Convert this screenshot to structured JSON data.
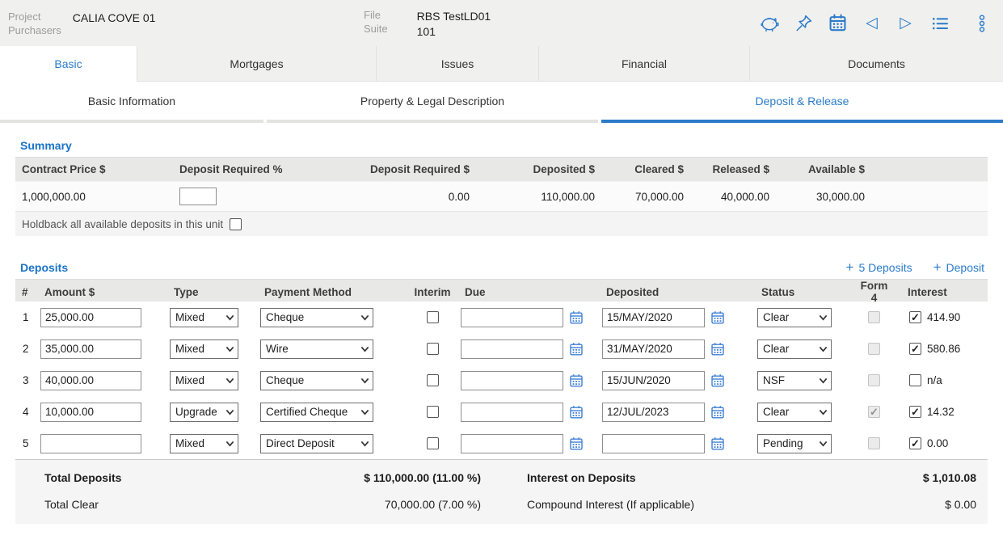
{
  "header": {
    "project_label": [
      "Project",
      "Purchasers"
    ],
    "project_value": "CALIA COVE 01",
    "file_label": [
      "File",
      "Suite"
    ],
    "file_value": [
      "RBS TestLD01",
      "101"
    ],
    "icons": [
      "piggy-bank",
      "pushpin",
      "calendar",
      "previous",
      "next",
      "list",
      "more-options"
    ]
  },
  "tabs": [
    {
      "label": "Basic",
      "active": true
    },
    {
      "label": "Mortgages",
      "active": false
    },
    {
      "label": "Issues",
      "active": false
    },
    {
      "label": "Financial",
      "active": false
    },
    {
      "label": "Documents",
      "active": false
    }
  ],
  "subtabs": [
    {
      "label": "Basic Information",
      "active": false
    },
    {
      "label": "Property & Legal Description",
      "active": false
    },
    {
      "label": "Deposit & Release",
      "active": true
    }
  ],
  "summary": {
    "title": "Summary",
    "columns": [
      "Contract Price $",
      "Deposit Required %",
      "Deposit Required $",
      "Deposited $",
      "Cleared $",
      "Released $",
      "Available $"
    ],
    "row": {
      "contract_price": "1,000,000.00",
      "deposit_required_pct": "",
      "deposit_required": "0.00",
      "deposited": "110,000.00",
      "cleared": "70,000.00",
      "released": "40,000.00",
      "available": "30,000.00"
    },
    "holdback_label": "Holdback all available deposits in this unit",
    "holdback_checked": false
  },
  "deposits": {
    "title": "Deposits",
    "add_five_label": "5 Deposits",
    "add_one_label": "Deposit",
    "columns": [
      "#",
      "Amount $",
      "Type",
      "Payment Method",
      "Interim",
      "Due",
      "Deposited",
      "Status",
      "Form 4",
      "Interest"
    ],
    "rows": [
      {
        "num": "1",
        "amount": "25,000.00",
        "type": "Mixed",
        "payment_method": "Cheque",
        "interim": false,
        "due": "",
        "deposited": "15/MAY/2020",
        "status": "Clear",
        "form4_checked": false,
        "interest_checked": true,
        "interest": "414.90"
      },
      {
        "num": "2",
        "amount": "35,000.00",
        "type": "Mixed",
        "payment_method": "Wire",
        "interim": false,
        "due": "",
        "deposited": "31/MAY/2020",
        "status": "Clear",
        "form4_checked": false,
        "interest_checked": true,
        "interest": "580.86"
      },
      {
        "num": "3",
        "amount": "40,000.00",
        "type": "Mixed",
        "payment_method": "Cheque",
        "interim": false,
        "due": "",
        "deposited": "15/JUN/2020",
        "status": "NSF",
        "form4_checked": false,
        "interest_checked": false,
        "interest": "n/a"
      },
      {
        "num": "4",
        "amount": "10,000.00",
        "type": "Upgrade",
        "payment_method": "Certified Cheque",
        "interim": false,
        "due": "",
        "deposited": "12/JUL/2023",
        "status": "Clear",
        "form4_checked": true,
        "interest_checked": true,
        "interest": "14.32"
      },
      {
        "num": "5",
        "amount": "",
        "type": "Mixed",
        "payment_method": "Direct Deposit",
        "interim": false,
        "due": "",
        "deposited": "",
        "status": "Pending",
        "form4_checked": false,
        "interest_checked": true,
        "interest": "0.00"
      }
    ],
    "totals": {
      "total_deposits_label": "Total Deposits",
      "total_deposits_value": "$ 110,000.00 (11.00 %)",
      "total_clear_label": "Total Clear",
      "total_clear_value": "70,000.00 (7.00 %)",
      "interest_label": "Interest on Deposits",
      "interest_value": "$ 1,010.08",
      "compound_label": "Compound Interest (If applicable)",
      "compound_value": "$ 0.00"
    }
  },
  "colors": {
    "accent": "#2b7bc9",
    "heading_blue": "#1a73c8",
    "header_bg": "#f0f0ef",
    "table_head_bg": "#e8e8e7"
  }
}
